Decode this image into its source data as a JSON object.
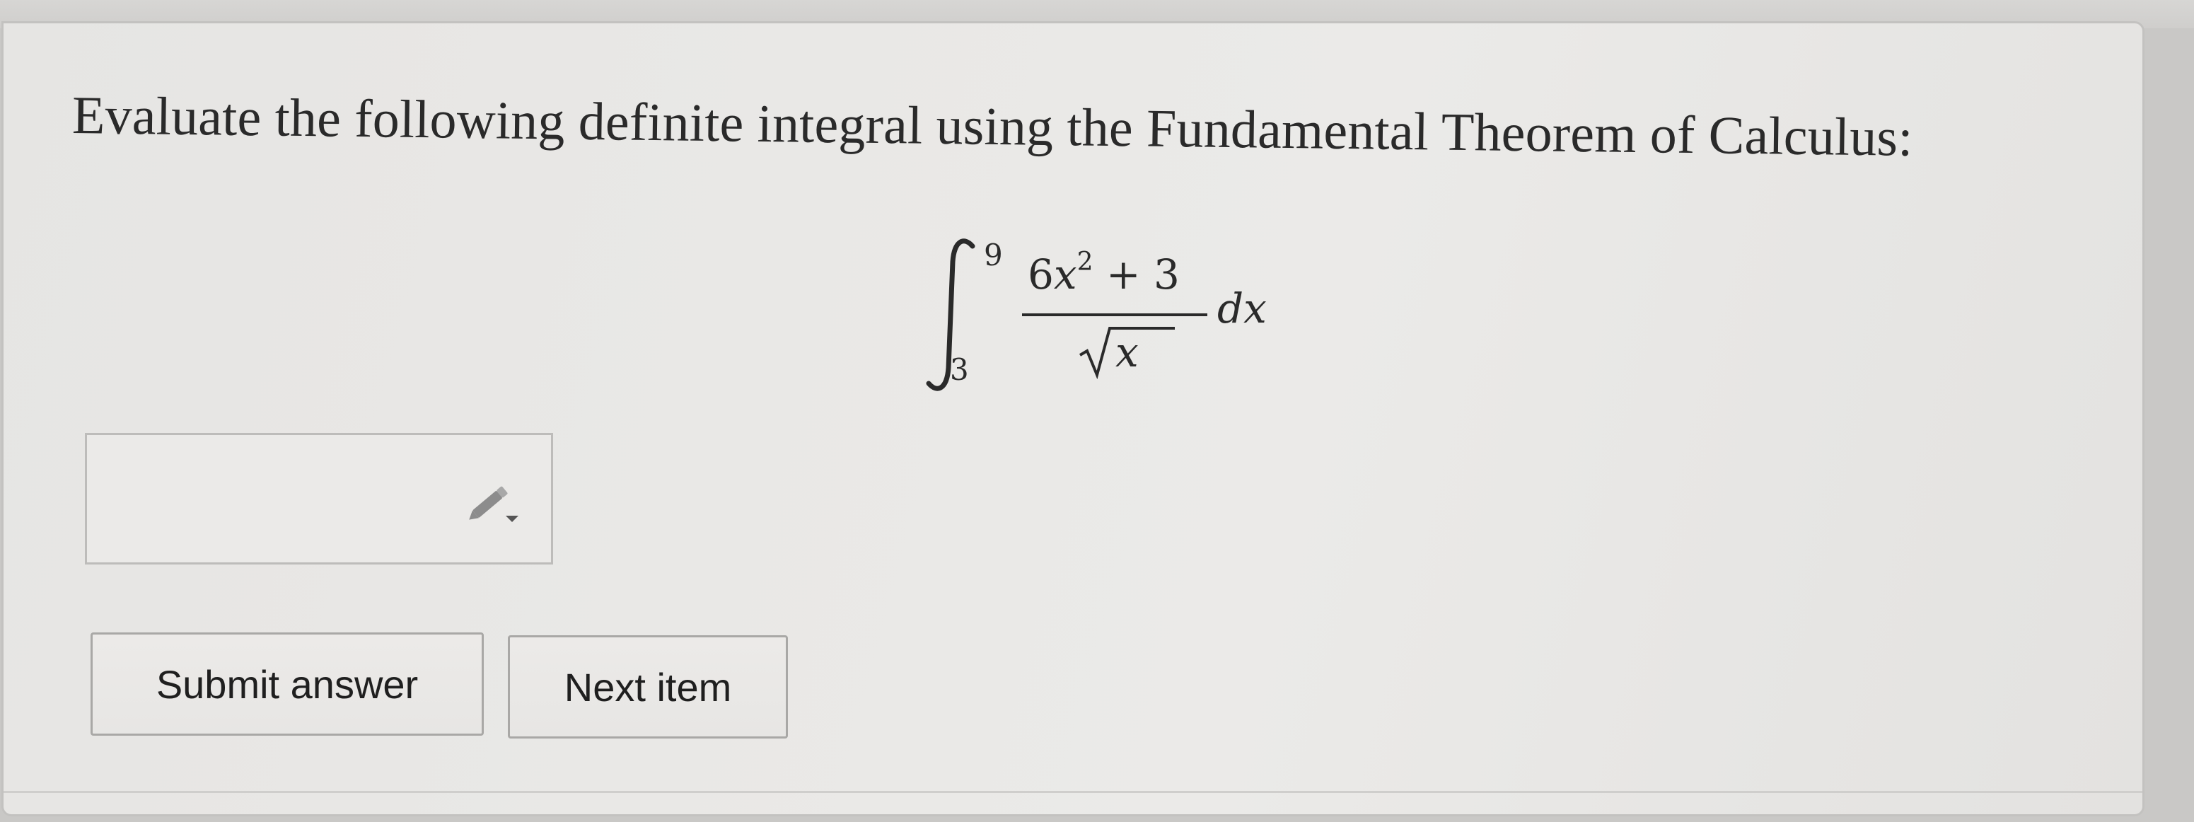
{
  "prompt": {
    "text": "Evaluate the following definite integral using the Fundamental Theorem of Calculus:"
  },
  "integral": {
    "upper_limit": "9",
    "lower_limit": "3",
    "numerator_coefficient": "6",
    "numerator_variable": "x",
    "numerator_exponent": "2",
    "numerator_rest": " + 3",
    "denominator_variable": "x",
    "differential": "dx"
  },
  "answer_input": {
    "value": "",
    "icon": "pencil-icon"
  },
  "buttons": {
    "submit_label": "Submit answer",
    "next_label": "Next item"
  }
}
